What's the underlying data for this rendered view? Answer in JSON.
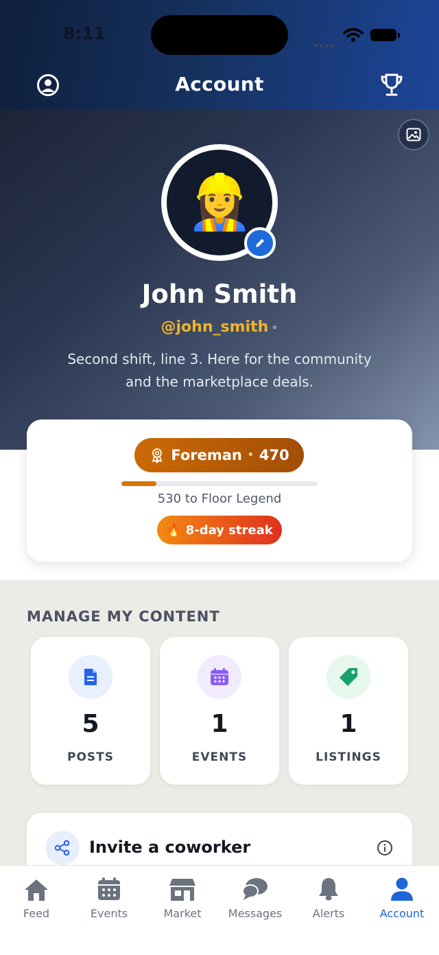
{
  "status_bar": {
    "time": "8:11"
  },
  "header": {
    "title": "Account"
  },
  "profile": {
    "avatar_emoji": "👷‍♀️",
    "name": "John Smith",
    "handle": "@john_smith",
    "handle_dot": "•",
    "bio": "Second shift, line 3. Here for the community and the marketplace deals."
  },
  "level": {
    "rank": "Foreman",
    "separator": "•",
    "points": "470",
    "progress_fraction": 0.18,
    "next_level_text": "530 to Floor Legend",
    "streak_emoji": "🔥",
    "streak_text": "8-day streak"
  },
  "manage": {
    "title": "MANAGE MY CONTENT",
    "cards": [
      {
        "count": "5",
        "label": "POSTS",
        "icon": "document-icon",
        "color": "#2563eb",
        "bg": "#e8effd"
      },
      {
        "count": "1",
        "label": "EVENTS",
        "icon": "calendar-icon",
        "color": "#8b5cf6",
        "bg": "#f1ecfd"
      },
      {
        "count": "1",
        "label": "LISTINGS",
        "icon": "tag-icon",
        "color": "#16a06a",
        "bg": "#e6f7ee"
      }
    ]
  },
  "invite": {
    "label": "Invite a coworker"
  },
  "tabs": [
    {
      "label": "Feed",
      "icon": "home-icon"
    },
    {
      "label": "Events",
      "icon": "calendar-icon"
    },
    {
      "label": "Market",
      "icon": "store-icon"
    },
    {
      "label": "Messages",
      "icon": "chat-icon"
    },
    {
      "label": "Alerts",
      "icon": "bell-icon"
    },
    {
      "label": "Account",
      "icon": "person-icon",
      "active": true
    }
  ],
  "colors": {
    "accent": "#1f66d6",
    "handle": "#f0b429",
    "rank_pill": "#b65a05",
    "streak": "#e55a1a",
    "inactive_tab": "#6b7280"
  }
}
